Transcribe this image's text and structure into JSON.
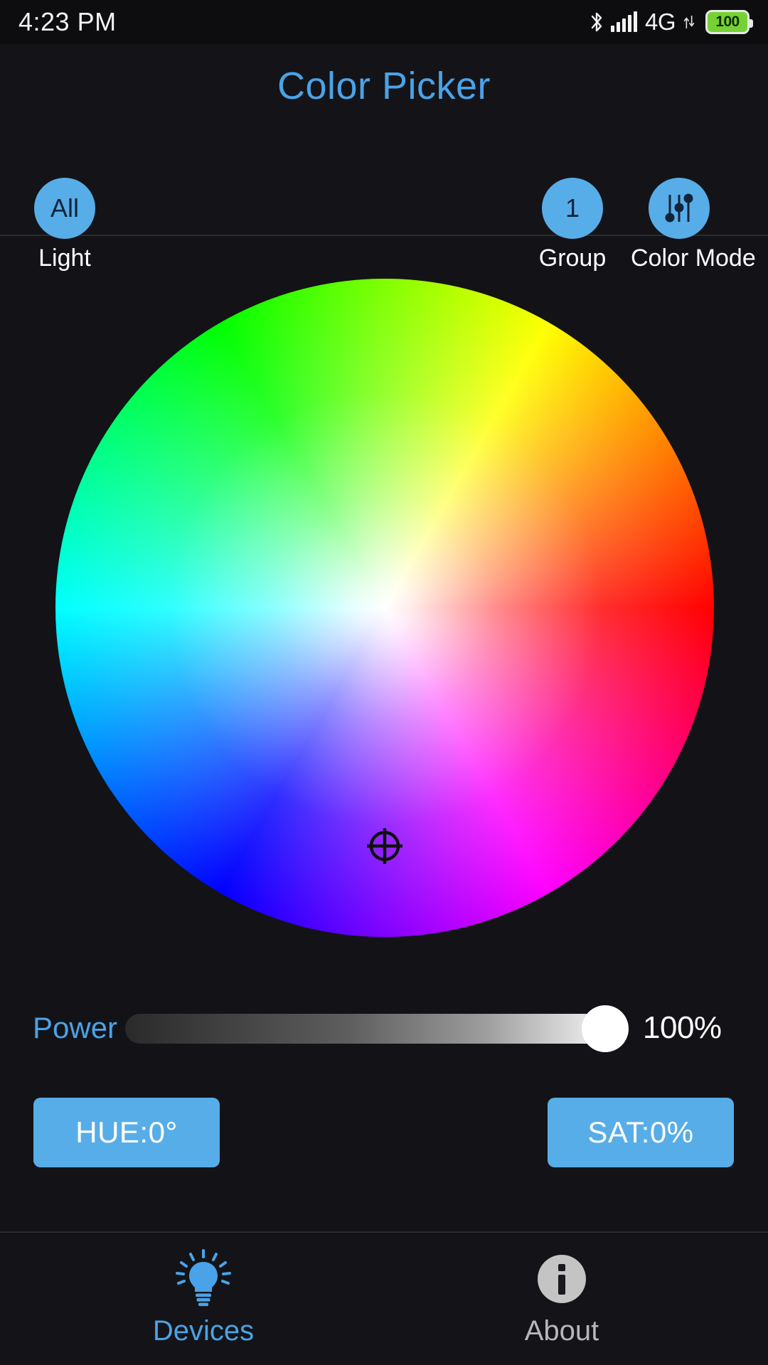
{
  "statusbar": {
    "time": "4:23 PM",
    "bluetooth_icon": "bluetooth-icon",
    "signal_icon": "signal-bars-icon",
    "network": "4G",
    "data_arrows_icon": "data-transfer-icon",
    "battery_percent": "100"
  },
  "header": {
    "title": "Color Picker",
    "light_button": {
      "value": "All",
      "label": "Light",
      "icon": "all-lights-icon"
    },
    "group_button": {
      "value": "1",
      "label": "Group",
      "icon": "group-number-icon"
    },
    "color_mode_button": {
      "label": "Color Mode",
      "icon": "sliders-icon"
    }
  },
  "wheel": {
    "name": "color-wheel",
    "marker_icon": "crosshair-icon"
  },
  "power": {
    "label": "Power",
    "value": "100%",
    "percent": 100
  },
  "readouts": {
    "hue": "HUE:0°",
    "sat": "SAT:0%"
  },
  "bottom_nav": {
    "items": [
      {
        "label": "Devices",
        "icon": "lightbulb-icon",
        "active": true
      },
      {
        "label": "About",
        "icon": "info-circle-icon",
        "active": false
      }
    ]
  },
  "colors": {
    "accent": "#57ade8",
    "accent_text": "#4aa3e8",
    "background": "#131317",
    "header_bg": "#141418",
    "battery_green": "#76d233",
    "inactive_text": "#b7b7b7"
  }
}
